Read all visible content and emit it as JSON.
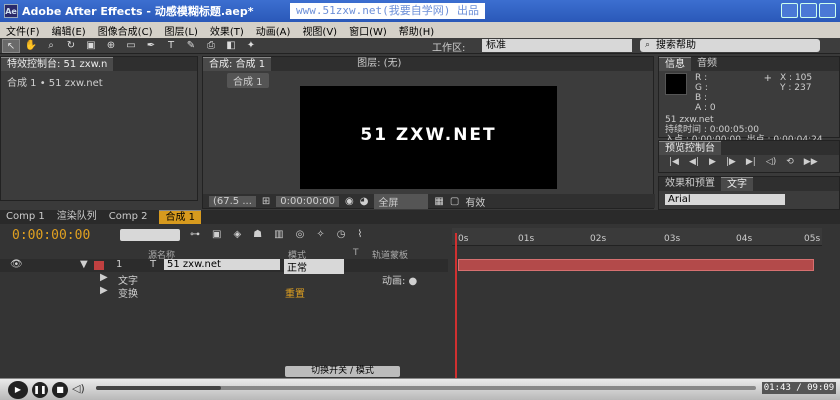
{
  "window": {
    "title": "Adobe After Effects - 动感模糊标题.aep*",
    "watermark": "www.51zxw.net(我要自学网) 出品"
  },
  "menu": [
    "文件(F)",
    "编辑(E)",
    "图像合成(C)",
    "图层(L)",
    "效果(T)",
    "动画(A)",
    "视图(V)",
    "窗口(W)",
    "帮助(H)"
  ],
  "toolbar": {
    "workspace_label": "工作区:",
    "workspace_value": "标准",
    "search_placeholder": "搜索帮助"
  },
  "effects_panel": {
    "tab": "特效控制台: 51 zxw.n",
    "breadcrumb": "合成 1 • 51 zxw.net"
  },
  "comp_panel": {
    "tab": "合成: 合成 1",
    "layer_tab": "图层: (无)",
    "subtab": "合成 1",
    "text": "51 ZXW.NET",
    "zoom": "(67.5 ...",
    "timecode": "0:00:00:00",
    "resolution": "全屏",
    "extra": "有效"
  },
  "info_panel": {
    "tabs": [
      "信息",
      "音频"
    ],
    "r": "R :",
    "g": "G :",
    "b": "B :",
    "a": "A : 0",
    "x": "X : 105",
    "y": "Y : 237",
    "layer": "51 zxw.net",
    "duration": "持续时间 : 0:00:05:00",
    "in_out": "入点 : 0:00:00:00, 出点 : 0:00:04:24"
  },
  "preview_panel": {
    "tab": "预览控制台"
  },
  "char_panel": {
    "tabs": [
      "效果和预置",
      "文字"
    ],
    "font": "Arial"
  },
  "timeline": {
    "tabs": [
      "Comp 1",
      "渲染队列",
      "Comp 2",
      "合成 1"
    ],
    "timecode": "0:00:00:00",
    "col_source": "源名称",
    "col_mode": "模式",
    "col_t": "T",
    "col_track": "轨道蒙板",
    "layer_num": "1",
    "layer_name": "51 zxw.net",
    "layer_mode": "正常",
    "row_text": "文字",
    "row_anim": "动画: ●",
    "row_transform": "变换",
    "row_reset": "重置",
    "ticks": [
      "0s",
      "01s",
      "02s",
      "03s",
      "04s",
      "05s"
    ],
    "switch_label": "切换开关 / 模式"
  },
  "player": {
    "time": "01:43 / 09:09",
    "progress": 0.19
  }
}
